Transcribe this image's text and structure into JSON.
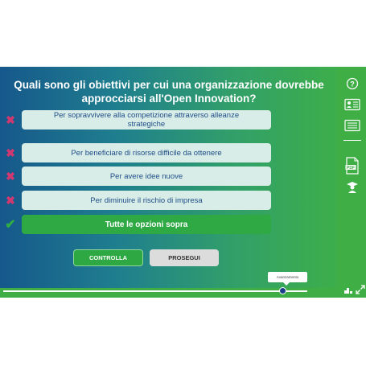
{
  "question": "Quali sono gli obiettivi per cui una organizzazione dovrebbe approcciarsi all'Open Innovation?",
  "options": [
    {
      "label": "Per sopravvivere alla competizione attraverso alleanze strategiche",
      "status": "wrong"
    },
    {
      "label": "Per beneficiare di risorse difficile da ottenere",
      "status": "wrong"
    },
    {
      "label": "Per avere idee nuove",
      "status": "wrong"
    },
    {
      "label": "Per diminuire il rischio di impresa",
      "status": "wrong"
    },
    {
      "label": "Tutte le opzioni sopra",
      "status": "correct"
    }
  ],
  "buttons": {
    "check": "CONTROLLA",
    "next": "PROSEGUI"
  },
  "progress": {
    "tooltip": "Avanzamento",
    "value": 0.92
  },
  "sidebar": {
    "icons": [
      "help-icon",
      "reader-icon",
      "notes-icon",
      "pdf-icon",
      "tutor-icon"
    ],
    "pdf_label": "PDF"
  },
  "bottom_icons": [
    "settings-icon",
    "fullscreen-icon"
  ],
  "colors": {
    "accent": "#3fae45",
    "wrong": "#d2386f",
    "correct": "#2ea944",
    "option_bg": "#d8ece8",
    "option_text": "#1e4d86"
  }
}
